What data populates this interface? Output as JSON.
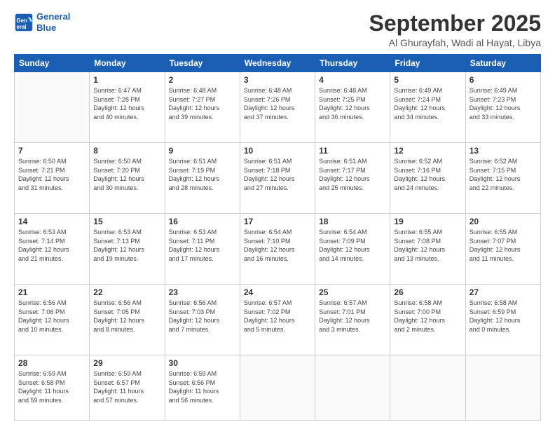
{
  "logo": {
    "line1": "General",
    "line2": "Blue"
  },
  "header": {
    "month": "September 2025",
    "location": "Al Ghurayfah, Wadi al Hayat, Libya"
  },
  "weekdays": [
    "Sunday",
    "Monday",
    "Tuesday",
    "Wednesday",
    "Thursday",
    "Friday",
    "Saturday"
  ],
  "weeks": [
    [
      {
        "day": "",
        "info": ""
      },
      {
        "day": "1",
        "info": "Sunrise: 6:47 AM\nSunset: 7:28 PM\nDaylight: 12 hours\nand 40 minutes."
      },
      {
        "day": "2",
        "info": "Sunrise: 6:48 AM\nSunset: 7:27 PM\nDaylight: 12 hours\nand 39 minutes."
      },
      {
        "day": "3",
        "info": "Sunrise: 6:48 AM\nSunset: 7:26 PM\nDaylight: 12 hours\nand 37 minutes."
      },
      {
        "day": "4",
        "info": "Sunrise: 6:48 AM\nSunset: 7:25 PM\nDaylight: 12 hours\nand 36 minutes."
      },
      {
        "day": "5",
        "info": "Sunrise: 6:49 AM\nSunset: 7:24 PM\nDaylight: 12 hours\nand 34 minutes."
      },
      {
        "day": "6",
        "info": "Sunrise: 6:49 AM\nSunset: 7:23 PM\nDaylight: 12 hours\nand 33 minutes."
      }
    ],
    [
      {
        "day": "7",
        "info": "Sunrise: 6:50 AM\nSunset: 7:21 PM\nDaylight: 12 hours\nand 31 minutes."
      },
      {
        "day": "8",
        "info": "Sunrise: 6:50 AM\nSunset: 7:20 PM\nDaylight: 12 hours\nand 30 minutes."
      },
      {
        "day": "9",
        "info": "Sunrise: 6:51 AM\nSunset: 7:19 PM\nDaylight: 12 hours\nand 28 minutes."
      },
      {
        "day": "10",
        "info": "Sunrise: 6:51 AM\nSunset: 7:18 PM\nDaylight: 12 hours\nand 27 minutes."
      },
      {
        "day": "11",
        "info": "Sunrise: 6:51 AM\nSunset: 7:17 PM\nDaylight: 12 hours\nand 25 minutes."
      },
      {
        "day": "12",
        "info": "Sunrise: 6:52 AM\nSunset: 7:16 PM\nDaylight: 12 hours\nand 24 minutes."
      },
      {
        "day": "13",
        "info": "Sunrise: 6:52 AM\nSunset: 7:15 PM\nDaylight: 12 hours\nand 22 minutes."
      }
    ],
    [
      {
        "day": "14",
        "info": "Sunrise: 6:53 AM\nSunset: 7:14 PM\nDaylight: 12 hours\nand 21 minutes."
      },
      {
        "day": "15",
        "info": "Sunrise: 6:53 AM\nSunset: 7:13 PM\nDaylight: 12 hours\nand 19 minutes."
      },
      {
        "day": "16",
        "info": "Sunrise: 6:53 AM\nSunset: 7:11 PM\nDaylight: 12 hours\nand 17 minutes."
      },
      {
        "day": "17",
        "info": "Sunrise: 6:54 AM\nSunset: 7:10 PM\nDaylight: 12 hours\nand 16 minutes."
      },
      {
        "day": "18",
        "info": "Sunrise: 6:54 AM\nSunset: 7:09 PM\nDaylight: 12 hours\nand 14 minutes."
      },
      {
        "day": "19",
        "info": "Sunrise: 6:55 AM\nSunset: 7:08 PM\nDaylight: 12 hours\nand 13 minutes."
      },
      {
        "day": "20",
        "info": "Sunrise: 6:55 AM\nSunset: 7:07 PM\nDaylight: 12 hours\nand 11 minutes."
      }
    ],
    [
      {
        "day": "21",
        "info": "Sunrise: 6:56 AM\nSunset: 7:06 PM\nDaylight: 12 hours\nand 10 minutes."
      },
      {
        "day": "22",
        "info": "Sunrise: 6:56 AM\nSunset: 7:05 PM\nDaylight: 12 hours\nand 8 minutes."
      },
      {
        "day": "23",
        "info": "Sunrise: 6:56 AM\nSunset: 7:03 PM\nDaylight: 12 hours\nand 7 minutes."
      },
      {
        "day": "24",
        "info": "Sunrise: 6:57 AM\nSunset: 7:02 PM\nDaylight: 12 hours\nand 5 minutes."
      },
      {
        "day": "25",
        "info": "Sunrise: 6:57 AM\nSunset: 7:01 PM\nDaylight: 12 hours\nand 3 minutes."
      },
      {
        "day": "26",
        "info": "Sunrise: 6:58 AM\nSunset: 7:00 PM\nDaylight: 12 hours\nand 2 minutes."
      },
      {
        "day": "27",
        "info": "Sunrise: 6:58 AM\nSunset: 6:59 PM\nDaylight: 12 hours\nand 0 minutes."
      }
    ],
    [
      {
        "day": "28",
        "info": "Sunrise: 6:59 AM\nSunset: 6:58 PM\nDaylight: 11 hours\nand 59 minutes."
      },
      {
        "day": "29",
        "info": "Sunrise: 6:59 AM\nSunset: 6:57 PM\nDaylight: 11 hours\nand 57 minutes."
      },
      {
        "day": "30",
        "info": "Sunrise: 6:59 AM\nSunset: 6:56 PM\nDaylight: 11 hours\nand 56 minutes."
      },
      {
        "day": "",
        "info": ""
      },
      {
        "day": "",
        "info": ""
      },
      {
        "day": "",
        "info": ""
      },
      {
        "day": "",
        "info": ""
      }
    ]
  ]
}
